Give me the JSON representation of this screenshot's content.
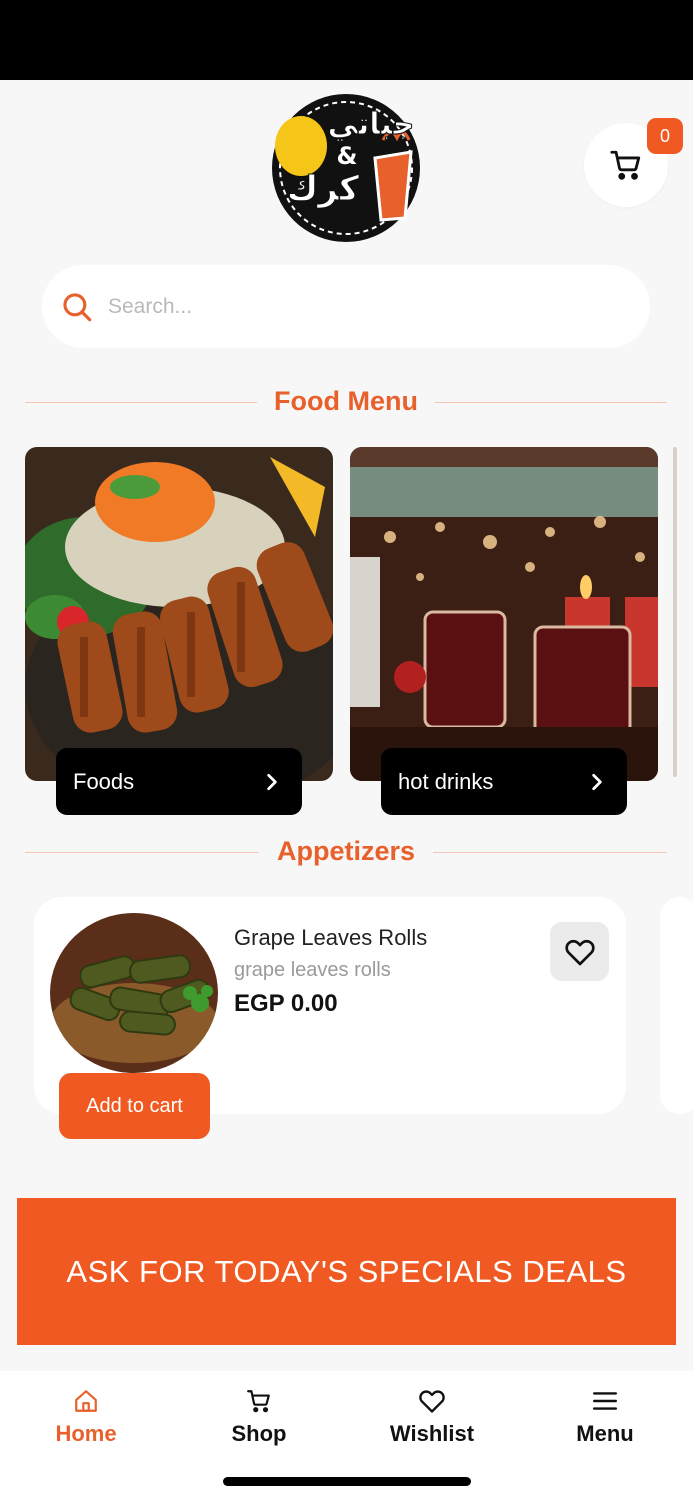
{
  "header": {
    "logo_text_top": "جباتي",
    "logo_amp": "&",
    "logo_text_bottom": "كرك",
    "cart_count": "0"
  },
  "search": {
    "placeholder": "Search..."
  },
  "sections": {
    "food_menu": "Food Menu",
    "appetizers": "Appetizers"
  },
  "categories": [
    {
      "label": "Foods"
    },
    {
      "label": "hot drinks"
    }
  ],
  "product": {
    "name": "Grape Leaves Rolls",
    "subtitle": "grape leaves rolls",
    "price": "EGP 0.00",
    "add_to_cart": "Add to cart"
  },
  "banner": {
    "text": "ASK FOR TODAY'S SPECIALS DEALS"
  },
  "bottom_nav": [
    {
      "label": "Home",
      "icon": "home-icon",
      "active": true
    },
    {
      "label": "Shop",
      "icon": "cart-icon",
      "active": false
    },
    {
      "label": "Wishlist",
      "icon": "heart-icon",
      "active": false
    },
    {
      "label": "Menu",
      "icon": "menu-icon",
      "active": false
    }
  ],
  "colors": {
    "accent": "#f05a22",
    "accent_text": "#e8602b",
    "background": "#f7f7f7",
    "dark": "#000000"
  }
}
